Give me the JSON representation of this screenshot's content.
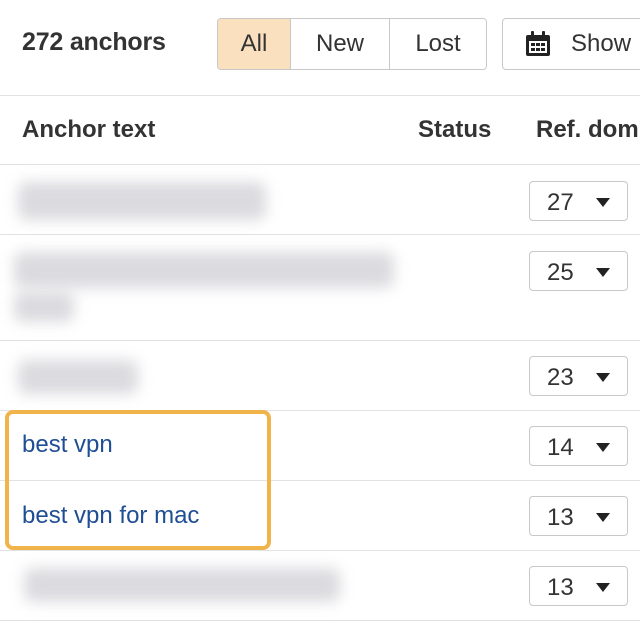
{
  "toolbar": {
    "count_label": "272 anchors",
    "filters": [
      "All",
      "New",
      "Lost"
    ],
    "active_filter": "All",
    "show_label": "Show"
  },
  "table": {
    "headers": {
      "anchor": "Anchor text",
      "status": "Status",
      "refdomains": "Ref. dom"
    },
    "rows": [
      {
        "anchor": "",
        "refdomains": "27"
      },
      {
        "anchor": "",
        "refdomains": "25"
      },
      {
        "anchor": "",
        "refdomains": "23"
      },
      {
        "anchor": "best vpn",
        "refdomains": "14"
      },
      {
        "anchor": "best vpn for mac",
        "refdomains": "13"
      },
      {
        "anchor": "",
        "refdomains": "13"
      }
    ]
  },
  "colors": {
    "active_filter_bg": "#fae0bf",
    "link": "#1f4e94",
    "highlight_border": "#f0b44a"
  }
}
